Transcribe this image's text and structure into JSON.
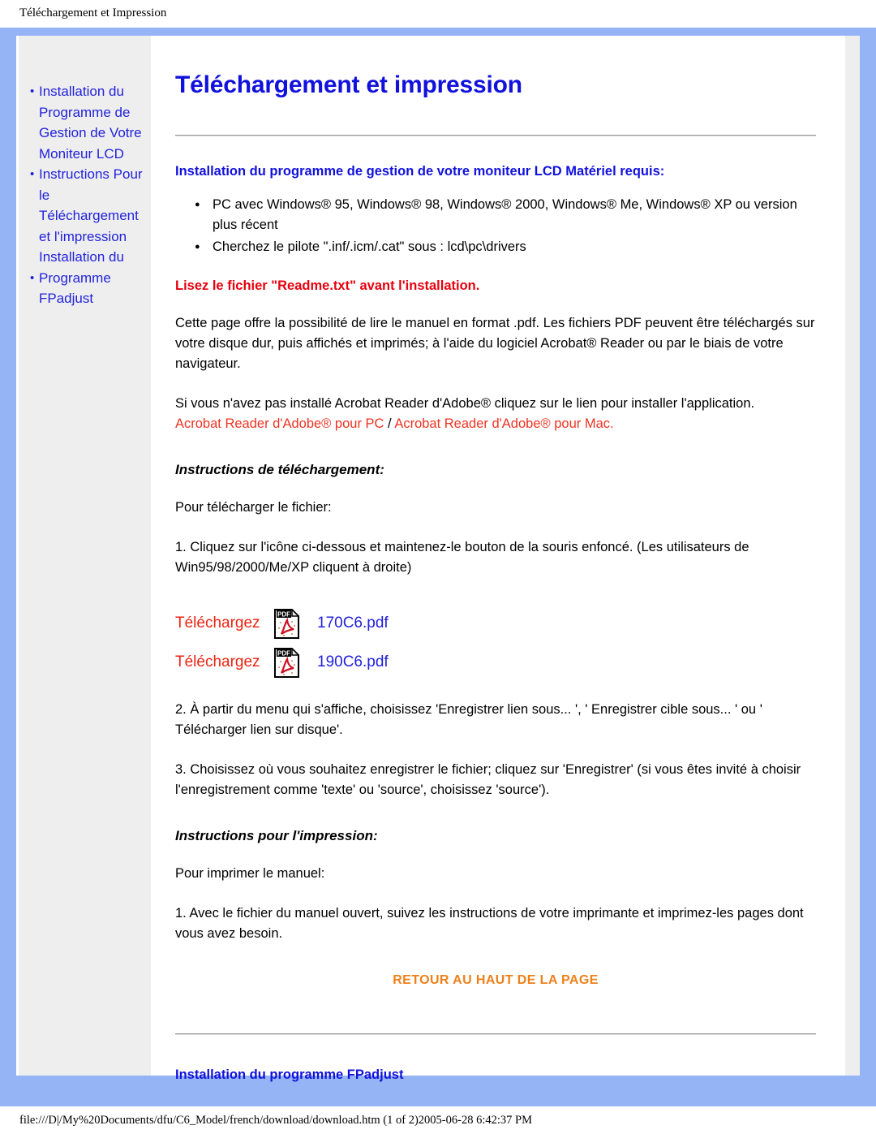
{
  "browser": {
    "print_header": "Téléchargement et Impression",
    "print_footer": "file:///D|/My%20Documents/dfu/C6_Model/french/download/download.htm (1 of 2)2005-06-28 6:42:37 PM"
  },
  "colors": {
    "frame_blue": "#95b4f5",
    "heading_blue": "#1111dd",
    "link_blue": "#2222dd",
    "warn_red": "#e8000d",
    "link_red": "#ee3322",
    "back_top_orange": "#ef8019",
    "sidebar_bg": "#eeeeee"
  },
  "sidebar": {
    "items": [
      {
        "label": "Installation du Programme de Gestion de Votre Moniteur LCD"
      },
      {
        "label": "Instructions Pour le Téléchargement et l'impression Installation du"
      },
      {
        "label": "Programme FPadjust"
      }
    ]
  },
  "main": {
    "title": "Téléchargement et impression",
    "section_heading": "Installation du programme de gestion de votre moniteur LCD Matériel requis:",
    "requirements": [
      "PC avec Windows® 95, Windows® 98, Windows® 2000, Windows® Me, Windows® XP ou version plus récent",
      "Cherchez le pilote \".inf/.icm/.cat\" sous : lcd\\pc\\drivers"
    ],
    "readme_warning": "Lisez le fichier \"Readme.txt\" avant l'installation.",
    "paragraph_pdf": "Cette page offre la possibilité de lire le manuel en format .pdf. Les fichiers PDF peuvent être téléchargés sur votre disque dur, puis affichés et imprimés; à l'aide du logiciel Acrobat® Reader ou par le biais de votre navigateur.",
    "paragraph_acrobat": "Si vous n'avez pas installé Acrobat Reader d'Adobe® cliquez sur le lien pour installer l'application.",
    "acrobat_link_pc": "Acrobat Reader d'Adobe® pour PC",
    "acrobat_link_sep": " / ",
    "acrobat_link_mac": "Acrobat Reader d'Adobe® pour Mac.",
    "download_heading": "Instructions de téléchargement:",
    "download_intro": "Pour télécharger le fichier:",
    "download_step1": "1. Cliquez sur l'icône ci-dessous et maintenez-le bouton de la souris enfoncé. (Les utilisateurs de Win95/98/2000/Me/XP cliquent à droite)",
    "downloads": [
      {
        "action_label": "Téléchargez",
        "icon": "pdf-icon",
        "file_name": "170C6.pdf"
      },
      {
        "action_label": "Téléchargez",
        "icon": "pdf-icon",
        "file_name": "190C6.pdf"
      }
    ],
    "download_step2": "2. À partir du menu qui s'affiche, choisissez 'Enregistrer lien sous... ', ' Enregistrer cible sous... ' ou ' Télécharger lien sur disque'.",
    "download_step3": "3. Choisissez où vous souhaitez enregistrer le fichier; cliquez sur 'Enregistrer' (si vous êtes invité à choisir l'enregistrement comme 'texte' ou 'source', choisissez 'source').",
    "print_heading": "Instructions pour l'impression:",
    "print_intro": "Pour imprimer le manuel:",
    "print_step1": "1. Avec le fichier du manuel ouvert, suivez les instructions de votre imprimante et imprimez-les pages dont vous avez besoin.",
    "back_to_top": "RETOUR AU HAUT DE LA PAGE",
    "fpadjust_heading": "Installation du programme FPadjust"
  }
}
